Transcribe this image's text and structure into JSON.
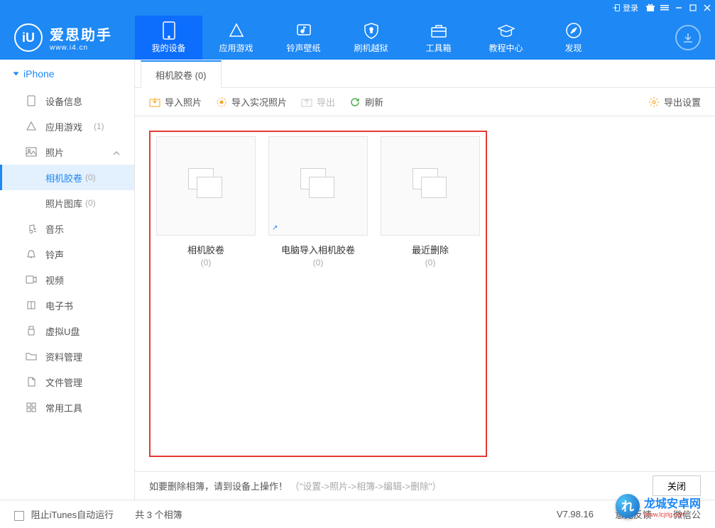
{
  "titlebar": {
    "login": "登录"
  },
  "logo": {
    "glyph": "iU",
    "main": "爱思助手",
    "sub": "www.i4.cn"
  },
  "nav": [
    {
      "label": "我的设备",
      "active": true
    },
    {
      "label": "应用游戏"
    },
    {
      "label": "铃声壁纸"
    },
    {
      "label": "刷机越狱"
    },
    {
      "label": "工具箱"
    },
    {
      "label": "教程中心"
    },
    {
      "label": "发现"
    }
  ],
  "sidebar": {
    "header": "iPhone",
    "items": [
      {
        "label": "设备信息"
      },
      {
        "label": "应用游戏",
        "count": "(1)"
      },
      {
        "label": "照片",
        "expandable": true,
        "expanded": true
      },
      {
        "label": "音乐"
      },
      {
        "label": "铃声"
      },
      {
        "label": "视频"
      },
      {
        "label": "电子书"
      },
      {
        "label": "虚拟U盘"
      },
      {
        "label": "资料管理"
      },
      {
        "label": "文件管理"
      },
      {
        "label": "常用工具"
      }
    ],
    "subs": [
      {
        "label": "相机胶卷",
        "count": "(0)",
        "active": true
      },
      {
        "label": "照片图库",
        "count": "(0)"
      }
    ]
  },
  "contentTab": {
    "label": "相机胶卷 (0)"
  },
  "toolbar": {
    "import_photo": "导入照片",
    "import_live": "导入实况照片",
    "export": "导出",
    "refresh": "刷新",
    "export_settings": "导出设置"
  },
  "albums": [
    {
      "title": "相机胶卷",
      "count": "(0)",
      "shortcut": false
    },
    {
      "title": "电脑导入相机胶卷",
      "count": "(0)",
      "shortcut": true
    },
    {
      "title": "最近删除",
      "count": "(0)",
      "shortcut": false
    }
  ],
  "footer": {
    "hint_main": "如要删除相簿，请到设备上操作！",
    "hint_path": "（\"设置->照片->相簿->编辑->删除\"）",
    "close": "关闭"
  },
  "status": {
    "block_itunes": "阻止iTunes自动运行",
    "album_count": "共 3 个相簿",
    "version": "V7.98.16",
    "feedback": "意见反馈",
    "wechat": "微信公"
  },
  "watermark": {
    "glyph": "れ",
    "text": "龙城安卓网",
    "sub": "www.lcjrlg.com"
  }
}
